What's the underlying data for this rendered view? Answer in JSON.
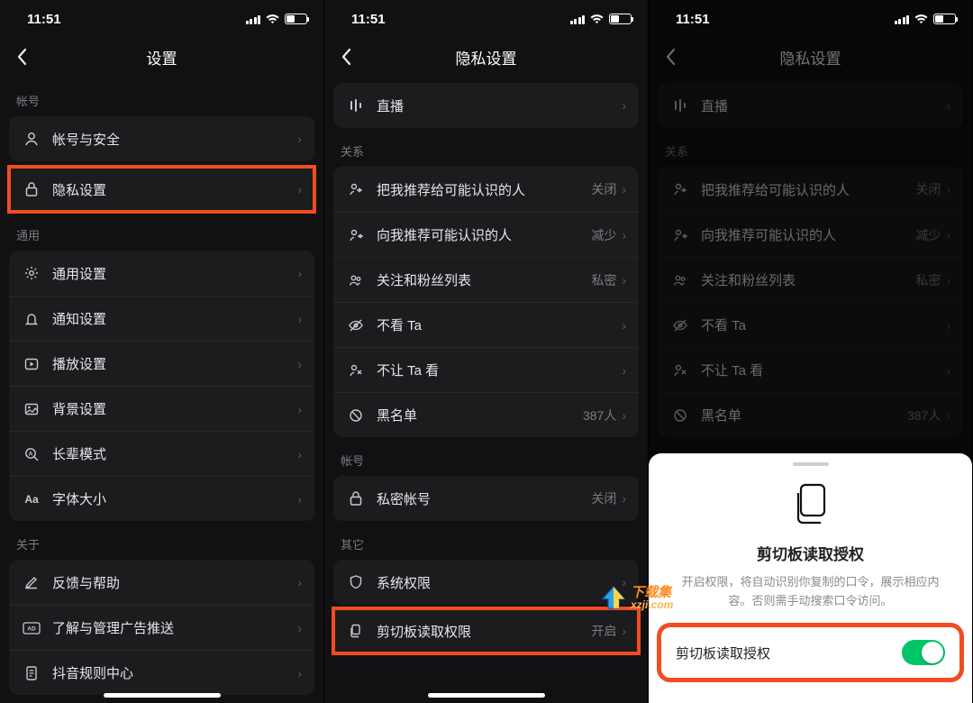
{
  "status": {
    "time": "11:51"
  },
  "left": {
    "title": "设置",
    "sec_account": "帐号",
    "row_account_security": "帐号与安全",
    "row_privacy": "隐私设置",
    "sec_general": "通用",
    "row_general": "通用设置",
    "row_notification": "通知设置",
    "row_playback": "播放设置",
    "row_background": "背景设置",
    "row_elder": "长辈模式",
    "row_font": "字体大小",
    "sec_about": "关于",
    "row_feedback": "反馈与帮助",
    "row_ads": "了解与管理广告推送",
    "row_rules": "抖音规则中心"
  },
  "mid": {
    "title": "隐私设置",
    "row_live": "直播",
    "sec_relation": "关系",
    "row_recommend_me": "把我推荐给可能认识的人",
    "val_recommend_me": "关闭",
    "row_recommend_to_me": "向我推荐可能认识的人",
    "val_recommend_to_me": "减少",
    "row_follow_list": "关注和粉丝列表",
    "val_follow_list": "私密",
    "row_not_see_ta": "不看 Ta",
    "row_ta_not_see": "不让 Ta 看",
    "row_blacklist": "黑名单",
    "val_blacklist": "387人",
    "sec_account": "帐号",
    "row_private_account": "私密帐号",
    "val_private_account": "关闭",
    "sec_other": "其它",
    "row_sys_perm": "系统权限",
    "row_clipboard": "剪切板读取权限",
    "val_clipboard": "开启"
  },
  "right": {
    "title": "隐私设置",
    "sheet_title": "剪切板读取授权",
    "sheet_desc": "开启权限，将自动识别你复制的口令，展示相应内容。否则需手动搜索口令访问。",
    "toggle_label": "剪切板读取授权"
  },
  "watermark": {
    "site": "xzji.com",
    "brand": "下载集"
  }
}
